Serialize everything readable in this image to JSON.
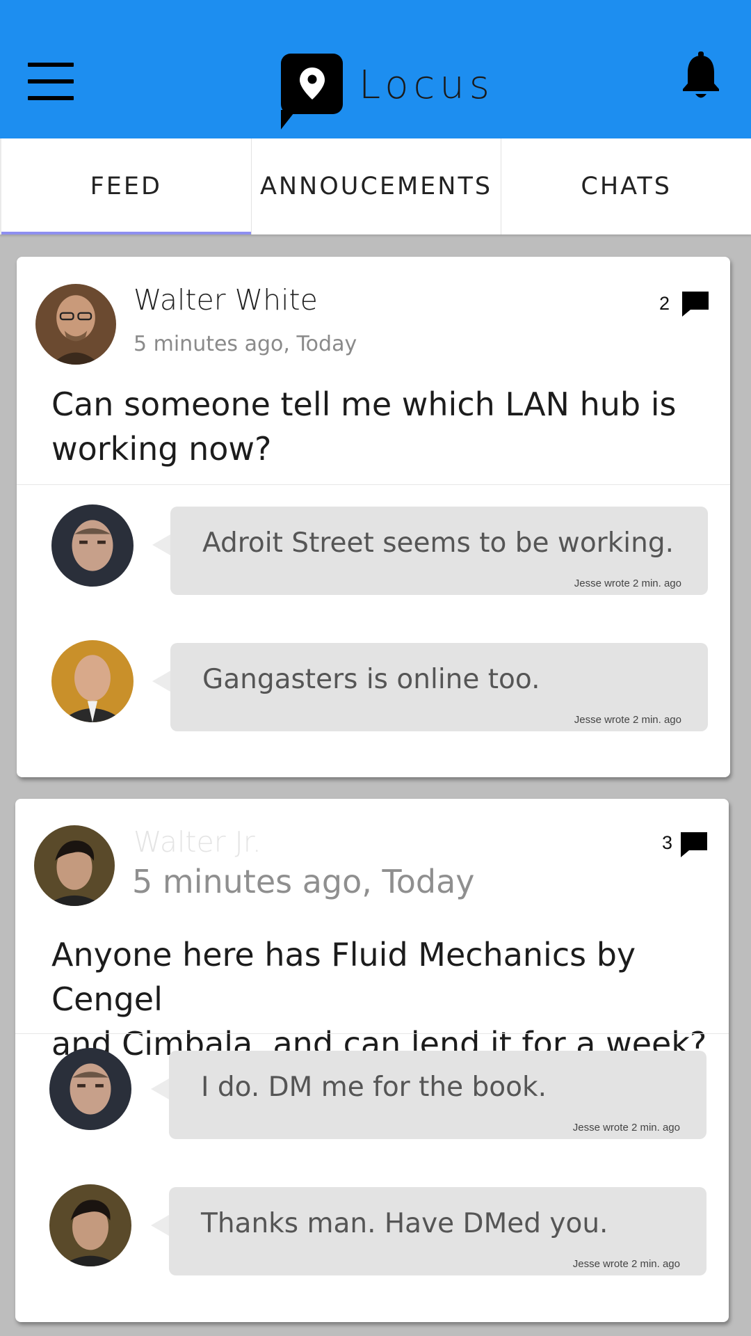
{
  "app": {
    "title": "Locus",
    "brand_color": "#1d8ef0",
    "tab_indicator_color": "#8e8ff0",
    "icons": {
      "menu": "hamburger-menu-icon",
      "logo": "map-pin-icon",
      "notifications": "bell-icon",
      "comments": "speech-bubble-icon"
    }
  },
  "tabs": [
    {
      "label": "FEED",
      "active": true
    },
    {
      "label": "ANNOUCEMENTS",
      "active": false
    },
    {
      "label": "CHATS",
      "active": false
    }
  ],
  "posts": [
    {
      "author": "Walter White",
      "time": "5 minutes ago, Today",
      "comment_count": "2",
      "body_line1": "Can someone tell me which LAN hub is",
      "body_line2": "working now?",
      "replies": [
        {
          "text": "Adroit Street seems to be working.",
          "meta": "Jesse wrote 2 min. ago"
        },
        {
          "text": "Gangasters is online too.",
          "meta": "Jesse wrote 2 min. ago"
        }
      ]
    },
    {
      "author": "Walter Jr.",
      "time": "5 minutes ago, Today",
      "comment_count": "3",
      "body_line1": "Anyone here has Fluid Mechanics by Cengel",
      "body_line2": "and Cimbala, and can lend it for a week?",
      "replies": [
        {
          "text": "I do. DM me for the book.",
          "meta": "Jesse wrote 2 min. ago"
        },
        {
          "text": "Thanks man. Have DMed you.",
          "meta": "Jesse wrote 2 min. ago"
        }
      ]
    }
  ]
}
